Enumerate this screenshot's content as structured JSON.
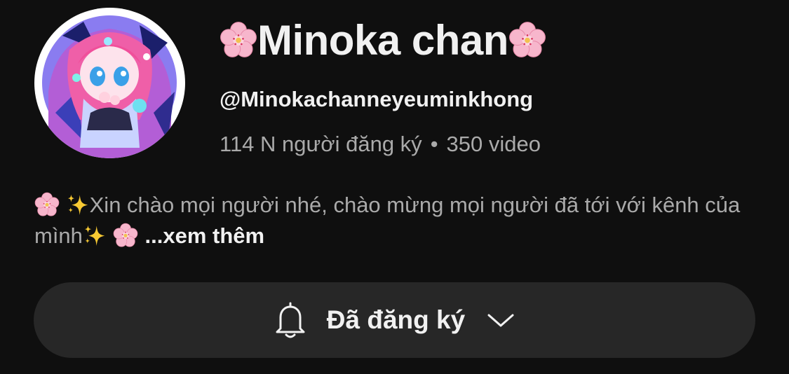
{
  "channel": {
    "name": "Minoka chan",
    "handle": "@Minokachanneyeuminkhong",
    "subscribers": "114 N người đăng ký",
    "separator": "•",
    "videos": "350 video",
    "description": "Xin chào mọi người nhé, chào mừng mọi người đã tới với kênh của mình",
    "see_more": "...xem thêm"
  },
  "subscribe_button": {
    "label": "Đã đăng ký"
  },
  "icons": {
    "avatar": "anime-avatar",
    "flower": "cherry-blossom-emoji",
    "sparkles": "sparkles-emoji",
    "bell": "bell-icon",
    "chevron": "chevron-down-icon"
  },
  "colors": {
    "background": "#0f0f0f",
    "button_bg": "#272727",
    "primary_text": "#f1f1f1",
    "secondary_text": "#aaaaaa"
  }
}
